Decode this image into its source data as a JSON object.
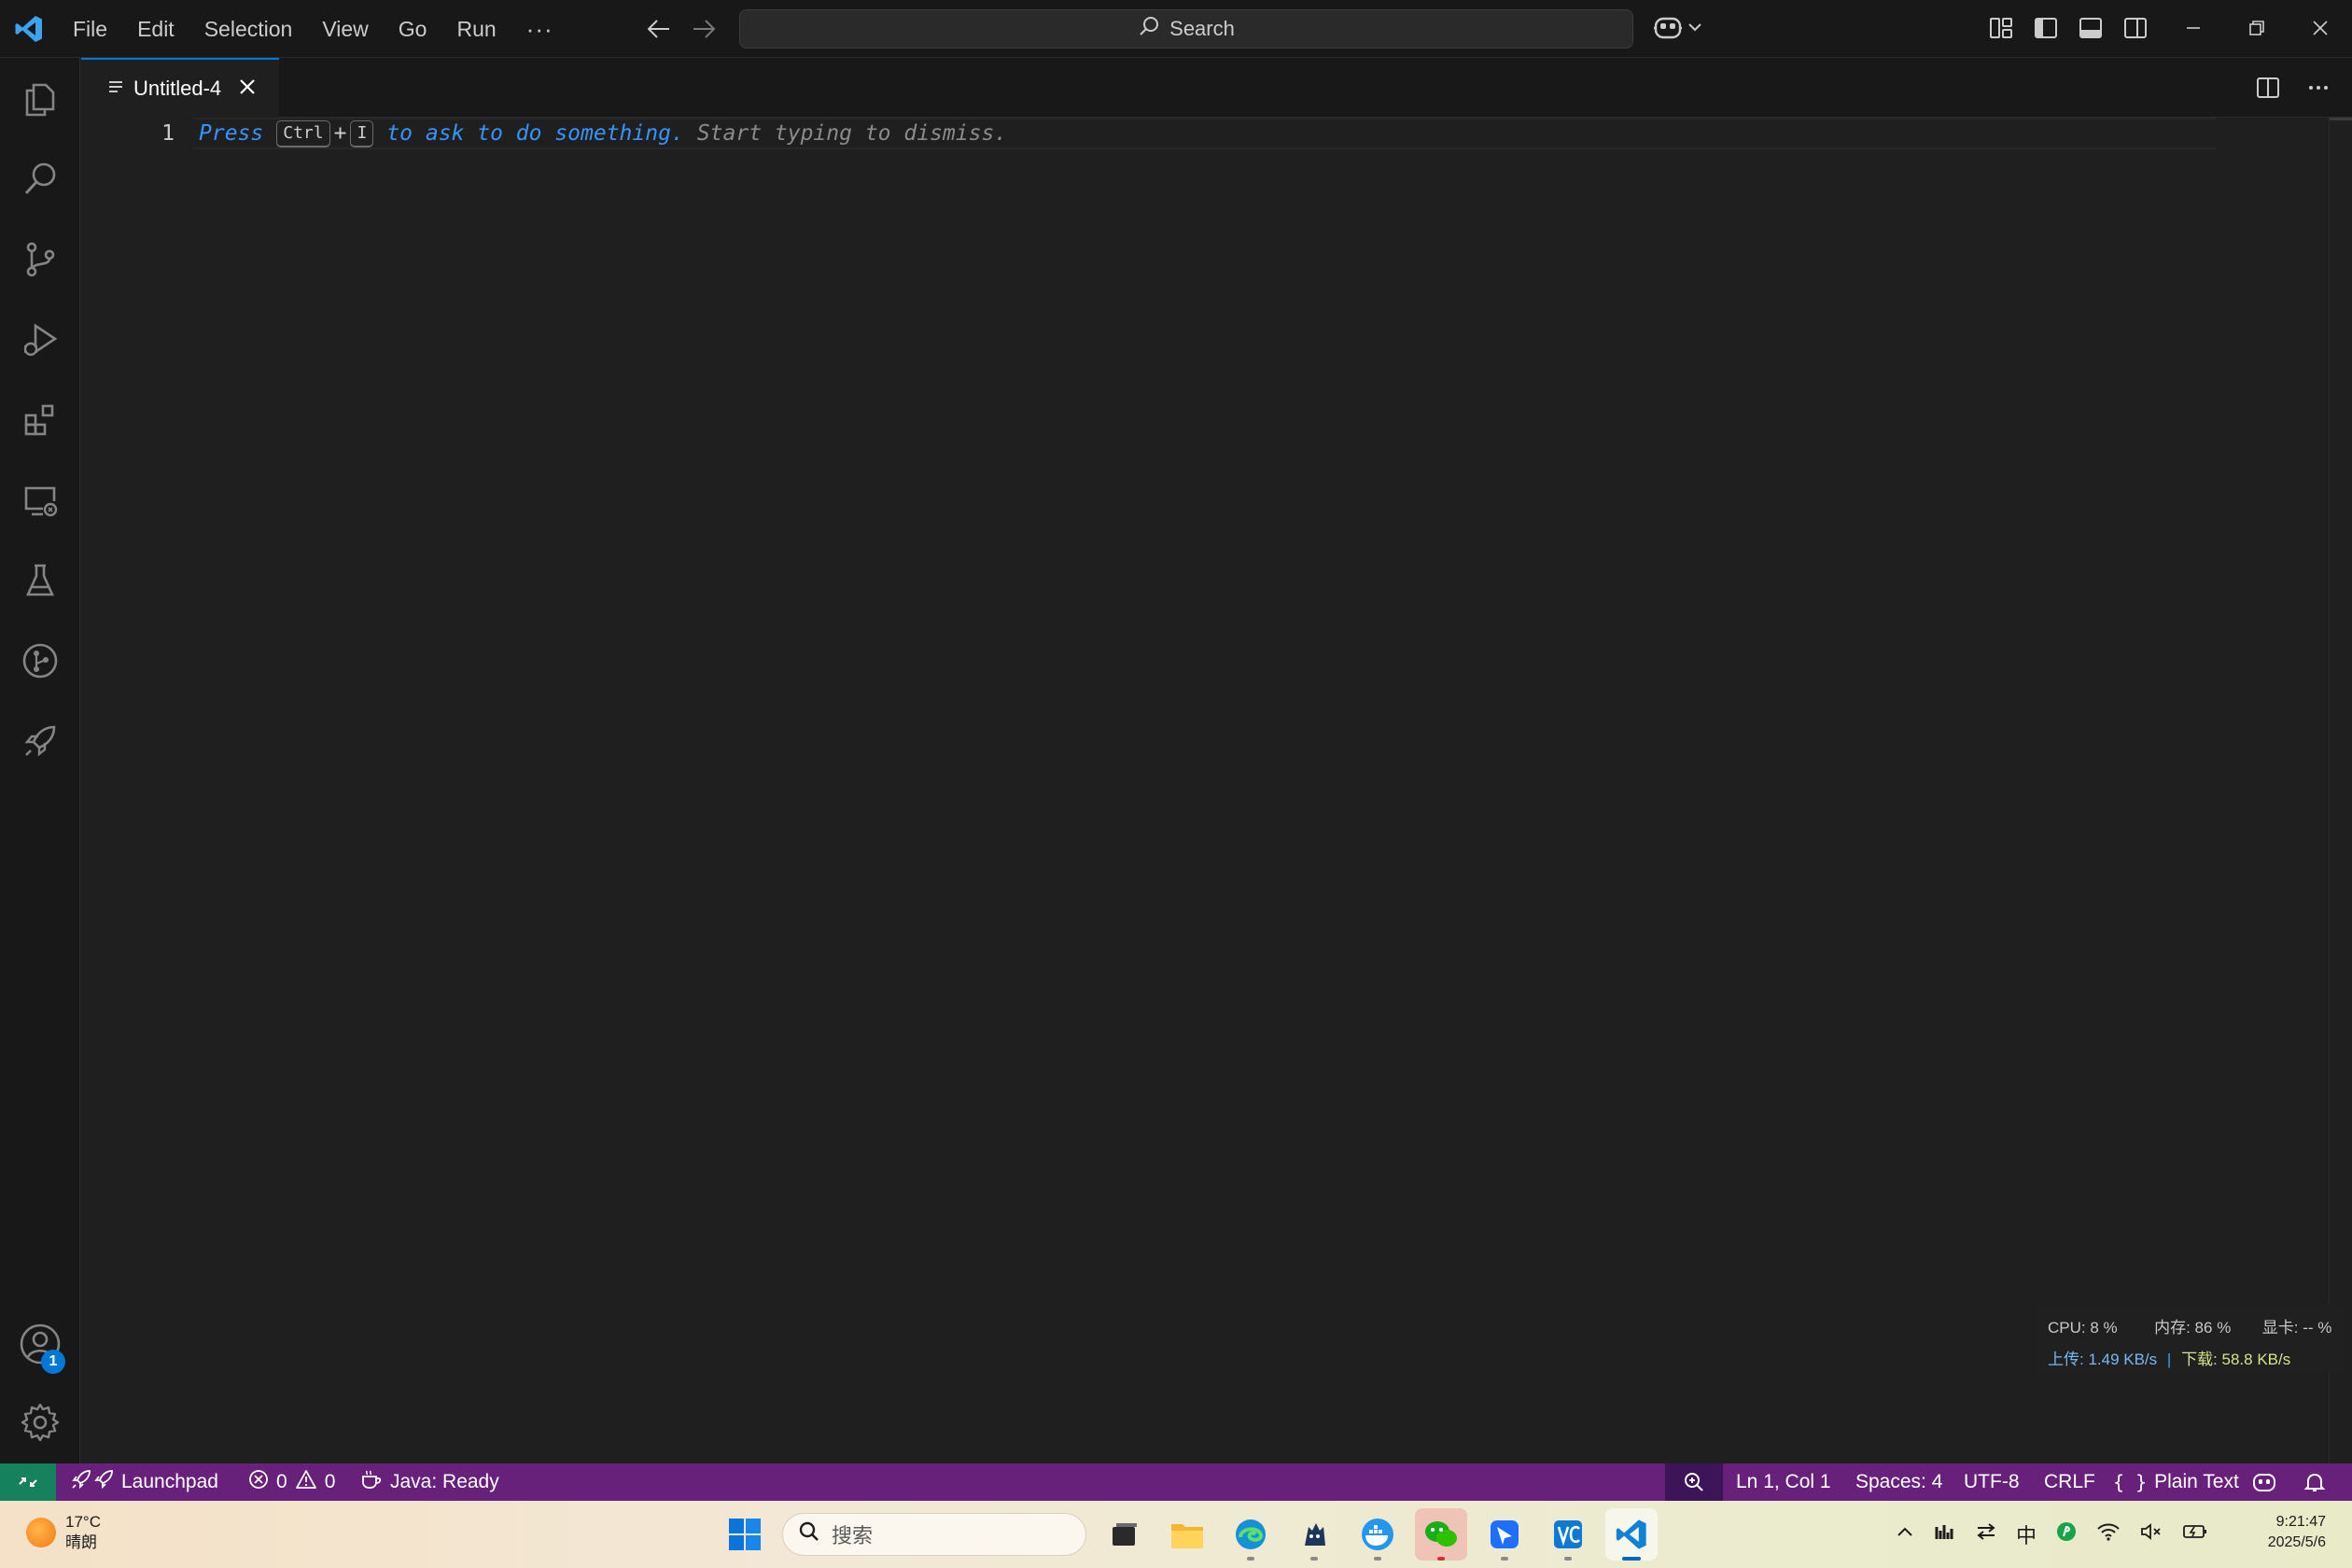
{
  "menu": {
    "items": [
      "File",
      "Edit",
      "Selection",
      "View",
      "Go",
      "Run"
    ],
    "more": "···"
  },
  "search": {
    "label": "Search"
  },
  "tab": {
    "label": "Untitled-4"
  },
  "editor": {
    "line_number": "1",
    "hint_press": "Press",
    "hint_key1": "Ctrl",
    "hint_plus": "+",
    "hint_key2": "I",
    "hint_ask": "to ask to do something.",
    "hint_dismiss": "Start typing to dismiss."
  },
  "activity": {
    "account_badge": "1"
  },
  "monitor": {
    "cpu": "CPU: 8 %",
    "mem": "内存: 86 %",
    "gpu": "显卡: -- %",
    "up": "上传: 1.49 KB/s",
    "down": "下载: 58.8 KB/s"
  },
  "status": {
    "launchpad": "Launchpad",
    "errors": "0",
    "warnings": "0",
    "java": "Java: Ready",
    "position": "Ln 1, Col 1",
    "spaces": "Spaces: 4",
    "encoding": "UTF-8",
    "eol": "CRLF",
    "language": "Plain Text"
  },
  "taskbar": {
    "temperature": "17°C",
    "weather": "晴朗",
    "search_placeholder": "搜索",
    "ime": "中",
    "time": "9:21:47",
    "date": "2025/5/6"
  },
  "colors": {
    "statusbar": "#68217a",
    "remote": "#16825d",
    "accent": "#0078d4",
    "hint_blue": "#3794ff"
  }
}
